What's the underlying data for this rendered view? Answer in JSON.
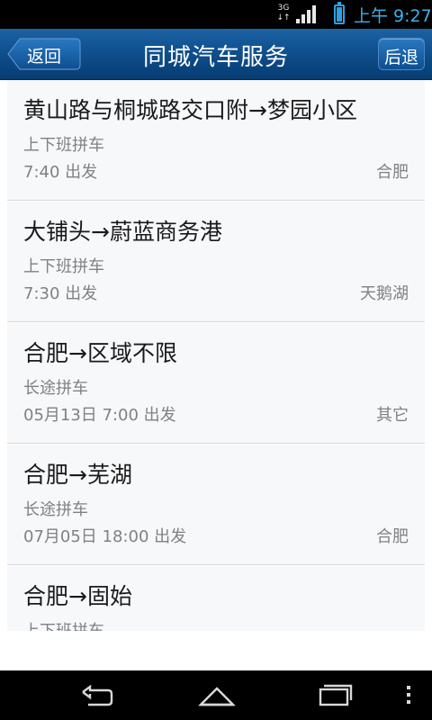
{
  "status_bar": {
    "network_label": "3G",
    "time": "上午 9:27"
  },
  "header": {
    "back_label": "返回",
    "title": "同城汽车服务",
    "after_label": "后退"
  },
  "listings": [
    {
      "route": "黄山路与桐城路交口附→梦园小区",
      "kind": "上下班拼车",
      "time": "7:40 出发",
      "place": "合肥"
    },
    {
      "route": "大铺头→蔚蓝商务港",
      "kind": "上下班拼车",
      "time": "7:30 出发",
      "place": "天鹅湖"
    },
    {
      "route": "合肥→区域不限",
      "kind": "长途拼车",
      "time": "05月13日 7:00 出发",
      "place": "其它"
    },
    {
      "route": "合肥→芜湖",
      "kind": "长途拼车",
      "time": "07月05日 18:00 出发",
      "place": "合肥"
    },
    {
      "route": "合肥→固始",
      "kind": "上下班拼车",
      "time": "",
      "place": ""
    }
  ],
  "nav_icons": [
    "back-icon",
    "home-icon",
    "recent-apps-icon",
    "menu-icon"
  ],
  "colors": {
    "header": "#0e4e8c",
    "status_accent": "#3bb0e8",
    "card_bg": "#f7f8fa"
  }
}
